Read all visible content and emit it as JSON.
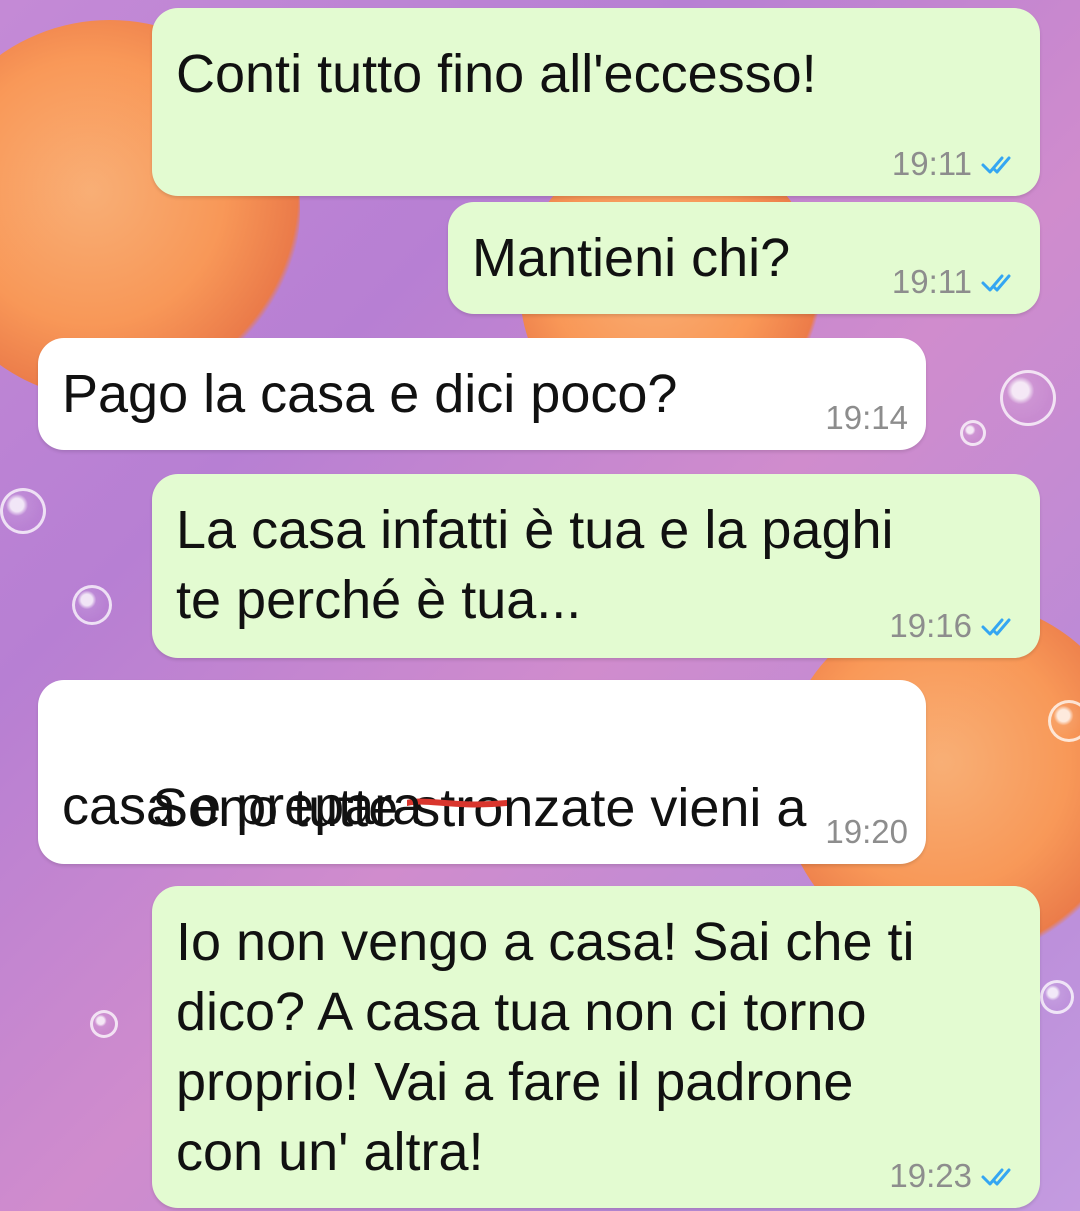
{
  "messages": [
    {
      "id": "m1",
      "direction": "outgoing",
      "text": "Conti tutto fino all'eccesso!",
      "time": "19:11",
      "status": "read"
    },
    {
      "id": "m2",
      "direction": "outgoing",
      "text": "Mantieni chi?",
      "time": "19:11",
      "status": "read"
    },
    {
      "id": "m3",
      "direction": "incoming",
      "text": "Pago la casa e dici poco?",
      "time": "19:14"
    },
    {
      "id": "m4",
      "direction": "outgoing",
      "line1": "La casa infatti è tua e la paghi",
      "line2": "te perché è tua...",
      "time": "19:16",
      "status": "read"
    },
    {
      "id": "m5",
      "direction": "incoming",
      "text_before": "Sono tutte ",
      "text_struck": "stronzate",
      "text_after": " vieni a",
      "line2": "casa e prepara",
      "time": "19:20"
    },
    {
      "id": "m6",
      "direction": "outgoing",
      "line1": "Io non vengo a casa! Sai che ti",
      "line2": "dico? A casa tua non ci torno",
      "line3": "proprio! Vai a fare il padrone",
      "line4": "con un' altra!",
      "time": "19:23",
      "status": "read"
    }
  ],
  "colors": {
    "outgoing_bubble": "#e3fbd1",
    "incoming_bubble": "#ffffff",
    "read_check": "#34a6f2",
    "strike_mark": "#d9352d"
  },
  "icons": {
    "read_receipt": "double-check-icon"
  }
}
